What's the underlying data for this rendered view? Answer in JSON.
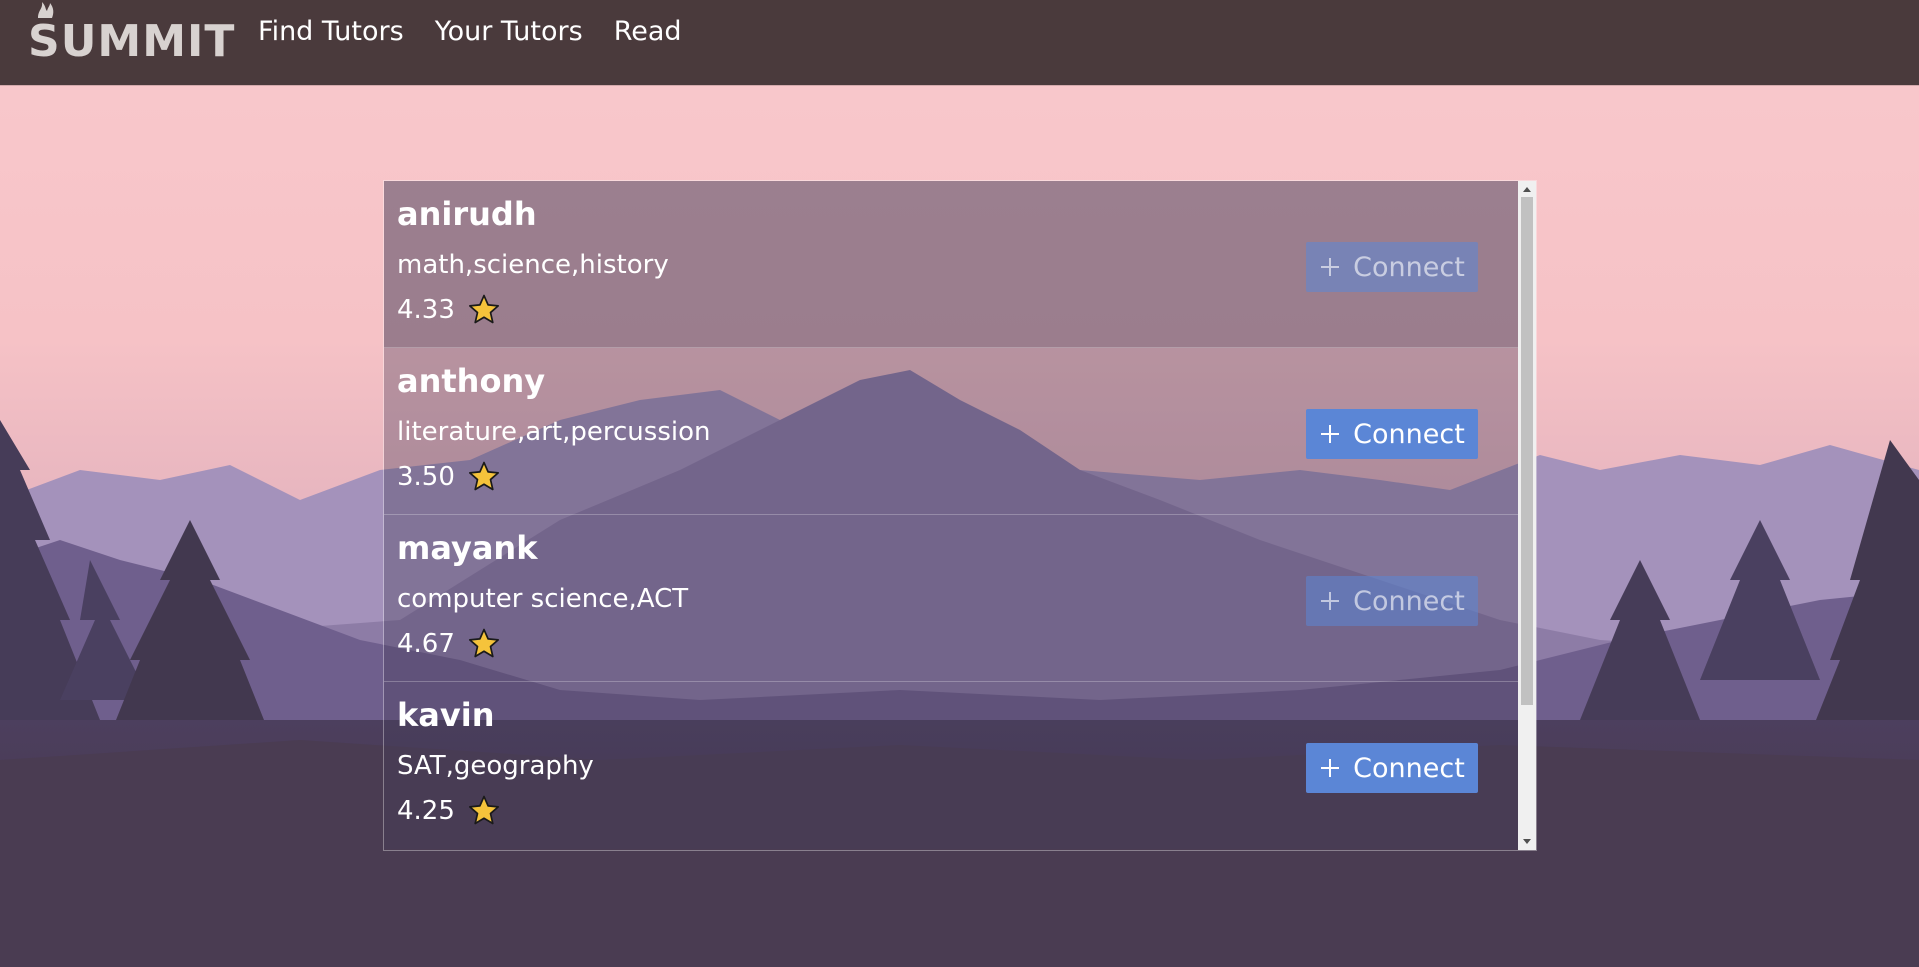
{
  "brand": {
    "name": "SUMMIT"
  },
  "nav": {
    "links": [
      {
        "label": "Find Tutors"
      },
      {
        "label": "Your Tutors"
      },
      {
        "label": "Read"
      }
    ]
  },
  "tutors": [
    {
      "name": "anirudh",
      "subjects": "math,science,history",
      "rating": "4.33",
      "button": "Connect"
    },
    {
      "name": "anthony",
      "subjects": "literature,art,percussion",
      "rating": "3.50",
      "button": "Connect"
    },
    {
      "name": "mayank",
      "subjects": "computer science,ACT",
      "rating": "4.67",
      "button": "Connect"
    },
    {
      "name": "kavin",
      "subjects": "SAT,geography",
      "rating": "4.25",
      "button": "Connect"
    }
  ],
  "colors": {
    "navbar": "#4a3a3c",
    "button": "#5b86d6",
    "star": "#f5c33b"
  }
}
